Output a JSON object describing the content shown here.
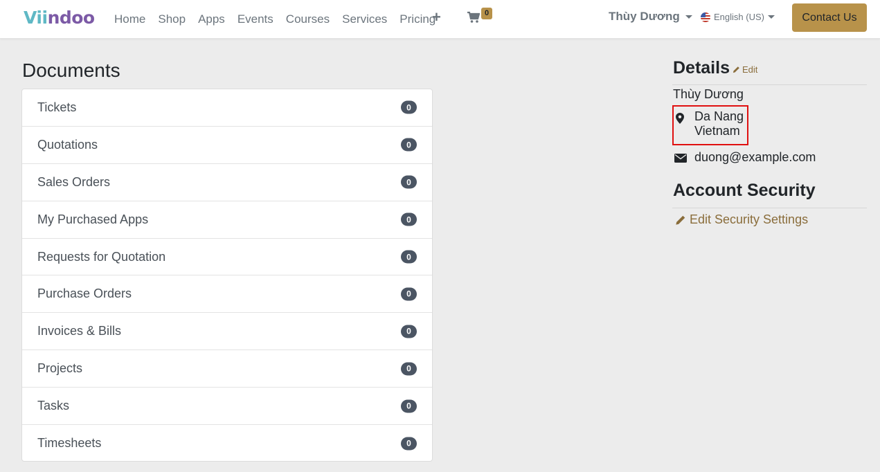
{
  "header": {
    "logo": {
      "part_a": "Vii",
      "part_b": "ndoo"
    },
    "nav": [
      "Home",
      "Shop",
      "Apps",
      "Events",
      "Courses",
      "Services",
      "Pricing"
    ],
    "plus": "+",
    "cart_count": "0",
    "user_name": "Thùy Dương",
    "language": "English (US)",
    "contact_label": "Contact Us"
  },
  "documents": {
    "title": "Documents",
    "items": [
      {
        "label": "Tickets",
        "count": "0"
      },
      {
        "label": "Quotations",
        "count": "0"
      },
      {
        "label": "Sales Orders",
        "count": "0"
      },
      {
        "label": "My Purchased Apps",
        "count": "0"
      },
      {
        "label": "Requests for Quotation",
        "count": "0"
      },
      {
        "label": "Purchase Orders",
        "count": "0"
      },
      {
        "label": "Invoices & Bills",
        "count": "0"
      },
      {
        "label": "Projects",
        "count": "0"
      },
      {
        "label": "Tasks",
        "count": "0"
      },
      {
        "label": "Timesheets",
        "count": "0"
      }
    ]
  },
  "details": {
    "title": "Details",
    "edit_label": "Edit",
    "name": "Thùy Dương",
    "city": "Da Nang",
    "country": "Vietnam",
    "email": "duong@example.com"
  },
  "security": {
    "title": "Account Security",
    "link_label": "Edit Security Settings"
  },
  "colors": {
    "accent": "#b8924a",
    "link": "#8a6d3b",
    "badge": "#4b5563",
    "highlight": "#e01010"
  }
}
